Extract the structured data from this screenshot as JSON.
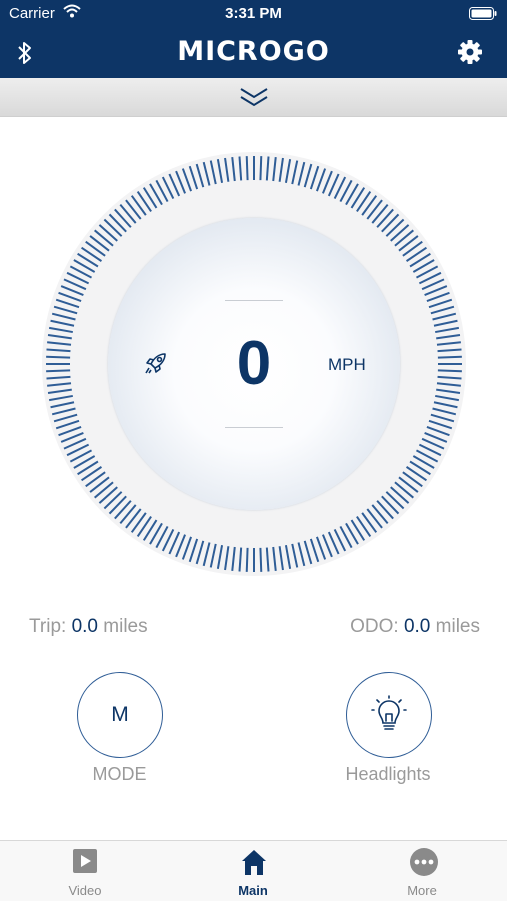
{
  "status_bar": {
    "carrier": "Carrier",
    "time": "3:31 PM",
    "icons": [
      "wifi-icon",
      "battery-icon"
    ]
  },
  "nav_bar": {
    "logo": "MICROGO",
    "icons": [
      "bluetooth-icon",
      "gear-icon"
    ]
  },
  "collapse_bar": {
    "icon": "chevron-down-icon"
  },
  "speedometer": {
    "speed": "0",
    "unit": "MPH",
    "mode_icon": "rocket-icon"
  },
  "stats": {
    "trip_label": "Trip:",
    "trip_value": "0.0",
    "trip_unit": "miles",
    "odo_label": "ODO:",
    "odo_value": "0.0",
    "odo_unit": "miles"
  },
  "controls": {
    "mode_letter": "M",
    "mode_label": "MODE",
    "headlights_label": "Headlights",
    "headlights_icon": "lightbulb-icon"
  },
  "tab_bar": {
    "tabs": [
      {
        "label": "Video",
        "icon": "video-play-icon",
        "active": false
      },
      {
        "label": "Main",
        "icon": "home-icon",
        "active": true
      },
      {
        "label": "More",
        "icon": "more-icon",
        "active": false
      }
    ]
  },
  "colors": {
    "brand_navy": "#0d3566",
    "accent_blue": "#2f5d96",
    "gray_text": "#9a9a9a"
  }
}
